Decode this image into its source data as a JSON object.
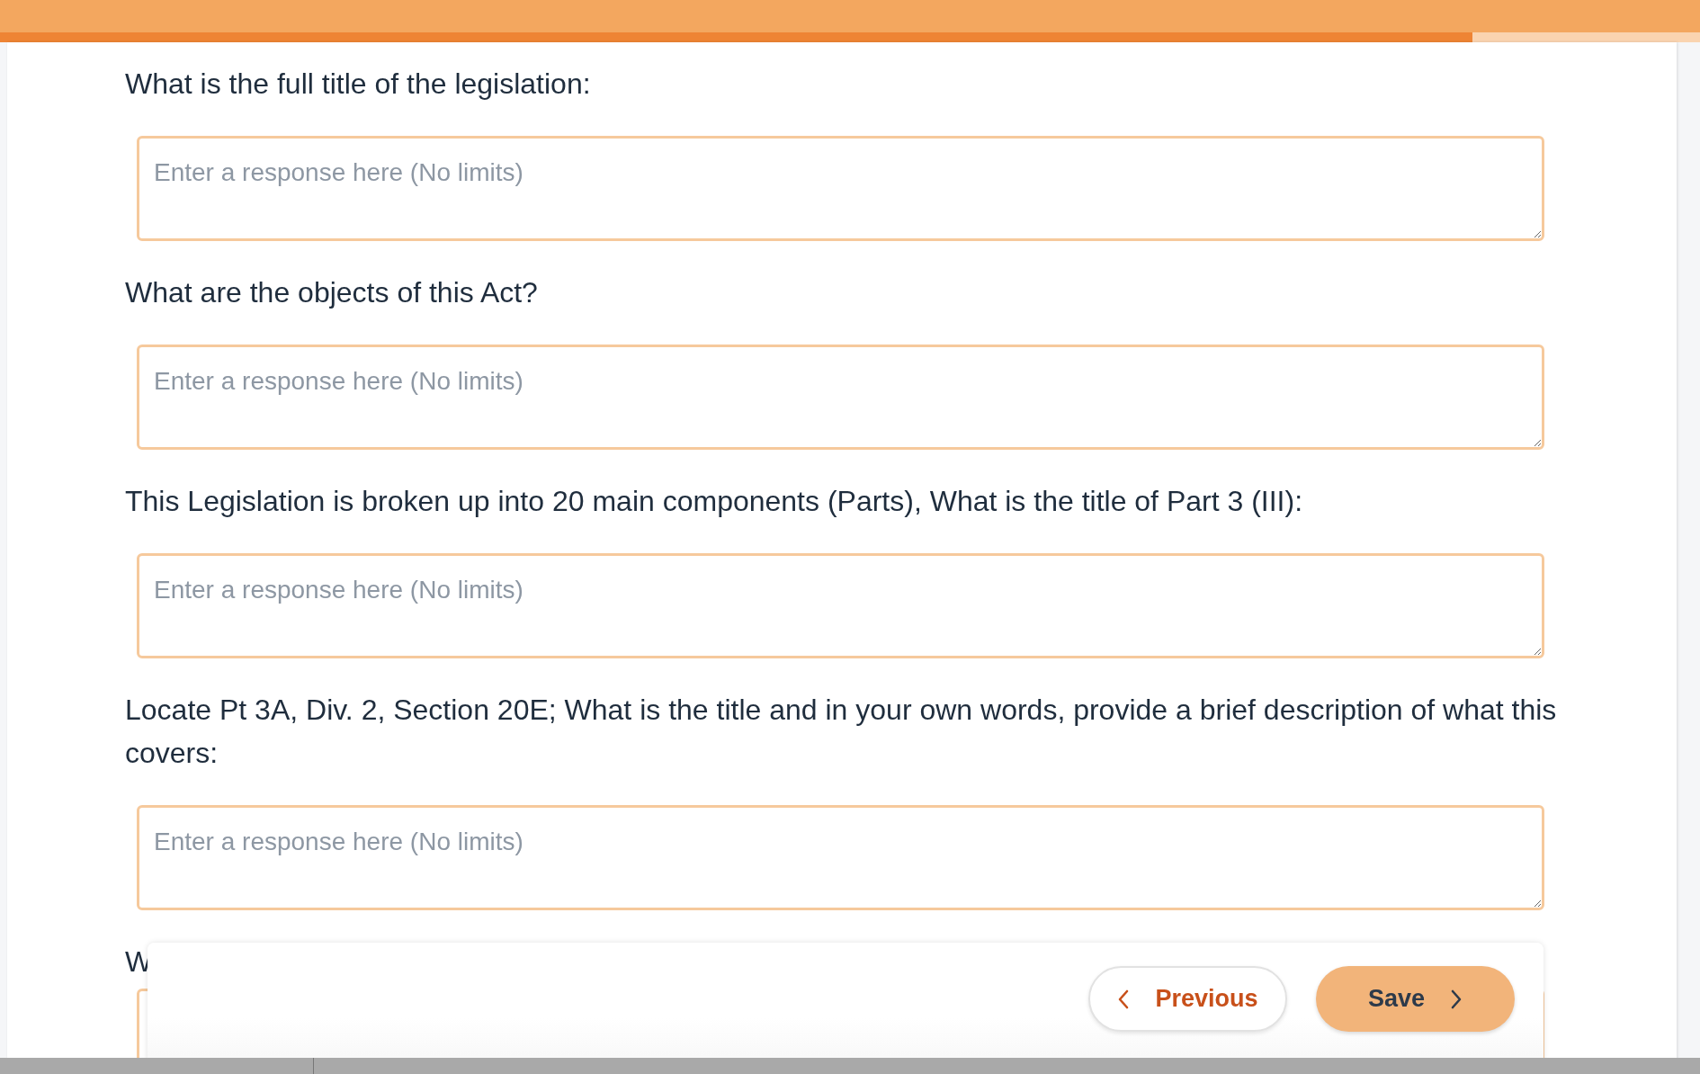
{
  "progress": {
    "level": 0.866
  },
  "questions": [
    {
      "prompt": "What is the full title of the legislation:",
      "placeholder": "Enter a response here (No limits)"
    },
    {
      "prompt": "What are the objects of this Act?",
      "placeholder": "Enter a response here (No limits)"
    },
    {
      "prompt": "This Legislation is broken up into 20 main components (Parts), What is the title of Part 3 (III):",
      "placeholder": "Enter a response here (No limits)"
    },
    {
      "prompt": "Locate Pt 3A, Div. 2, Section 20E; What is the title and in your own words, provide a brief description of what this covers:",
      "placeholder": "Enter a response here (No limits)"
    },
    {
      "prompt": "W"
    }
  ],
  "buttons": [
    {
      "kind": "previous",
      "label": "Previous"
    },
    {
      "kind": "next",
      "label": "Save"
    }
  ]
}
